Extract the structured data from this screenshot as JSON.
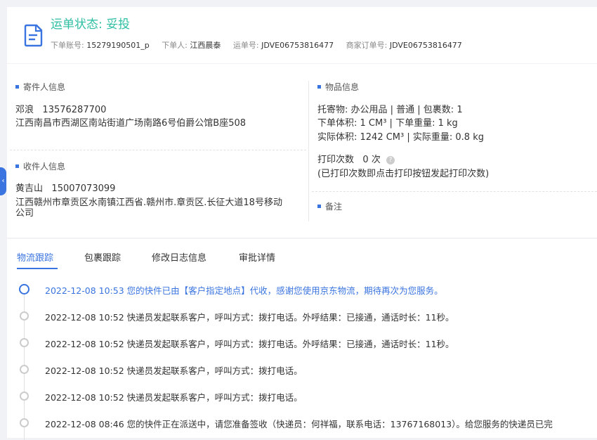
{
  "header": {
    "status_label": "运单状态: ",
    "status_value": "妥投",
    "account_label": "下单账号:",
    "account": "15279190501_p",
    "orderer_label": "下单人:",
    "orderer": "江西晨泰",
    "waybill_label": "运单号:",
    "waybill": "JDVE06753816477",
    "merchant_label": "商家订单号:",
    "merchant_order": "JDVE06753816477"
  },
  "sender": {
    "title": "寄件人信息",
    "name": "邓浪",
    "phone": "13576287700",
    "address": "江西南昌市西湖区南站街道广场南路6号伯爵公馆B座508"
  },
  "receiver": {
    "title": "收件人信息",
    "name": "黄吉山",
    "phone": "15007073099",
    "address_line1": "江西赣州市章贡区水南镇江西省.赣州市.章贡区.长征大道18号移动",
    "address_line2": "公司"
  },
  "goods": {
    "title": "物品信息",
    "line1": "托寄物:  办公用品 | 普通  |  包裹数:  1",
    "line2": "下单体积:    1 CM³  |  下单重量:    1 kg",
    "line3": "实际体积:    1242 CM³  |  实际重量:    0.8 kg",
    "print_label": "打印次数",
    "print_count": "0 次",
    "print_hint": "(已打印次数即点击打印按钮发起打印次数)"
  },
  "remark": {
    "title": "备注"
  },
  "tabs": [
    "物流跟踪",
    "包裹跟踪",
    "修改日志信息",
    "审批详情"
  ],
  "timeline": [
    "2022-12-08 10:53 您的快件已由【客户指定地点】代收，感谢您使用京东物流，期待再次为您服务。",
    "2022-12-08 10:52 快递员发起联系客户，呼叫方式：拨打电话。外呼结果：已接通，通话时长：11秒。",
    "2022-12-08 10:52 快递员发起联系客户，呼叫方式：拨打电话。外呼结果：已接通，通话时长：11秒。",
    "2022-12-08 10:52 快递员发起联系客户，呼叫方式：拨打电话。",
    "2022-12-08 10:52 快递员发起联系客户，呼叫方式：拨打电话。",
    "2022-12-08 08:46 您的快件正在派送中，请您准备签收（快递员：何祥福，联系电话：13767168013）。给您服务的快递员已完"
  ],
  "side_tab_glyph": "‹",
  "help_glyph": "?",
  "colors": {
    "accent": "#3a74e0",
    "status": "#2fbfa3"
  }
}
